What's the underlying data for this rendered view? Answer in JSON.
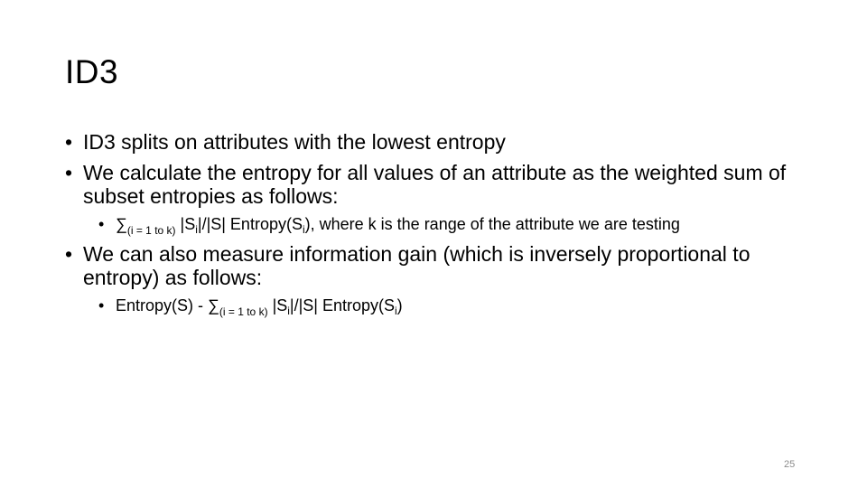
{
  "slide": {
    "title": "ID3",
    "bullets": [
      {
        "text": "ID3 splits on attributes with the lowest entropy"
      },
      {
        "text": "We calculate the entropy for all values of an attribute as the weighted sum of subset entropies as follows:",
        "sub": {
          "sum_symbol": "∑",
          "range": "(i = 1 to k)",
          "part_a": " |S",
          "index": "i",
          "part_b": "|/|S| Entropy(S",
          "part_c": "), where k is the range of the attribute we are testing"
        }
      },
      {
        "text": "We can also measure information gain (which is inversely proportional to entropy) as follows:",
        "sub": {
          "prefix": "Entropy(S) - ",
          "sum_symbol": "∑",
          "range": "(i = 1 to k)",
          "part_a": " |S",
          "index": "i",
          "part_b": "|/|S| Entropy(S",
          "part_c": ")"
        }
      }
    ],
    "bullet_char": "•",
    "page_number": "25"
  }
}
